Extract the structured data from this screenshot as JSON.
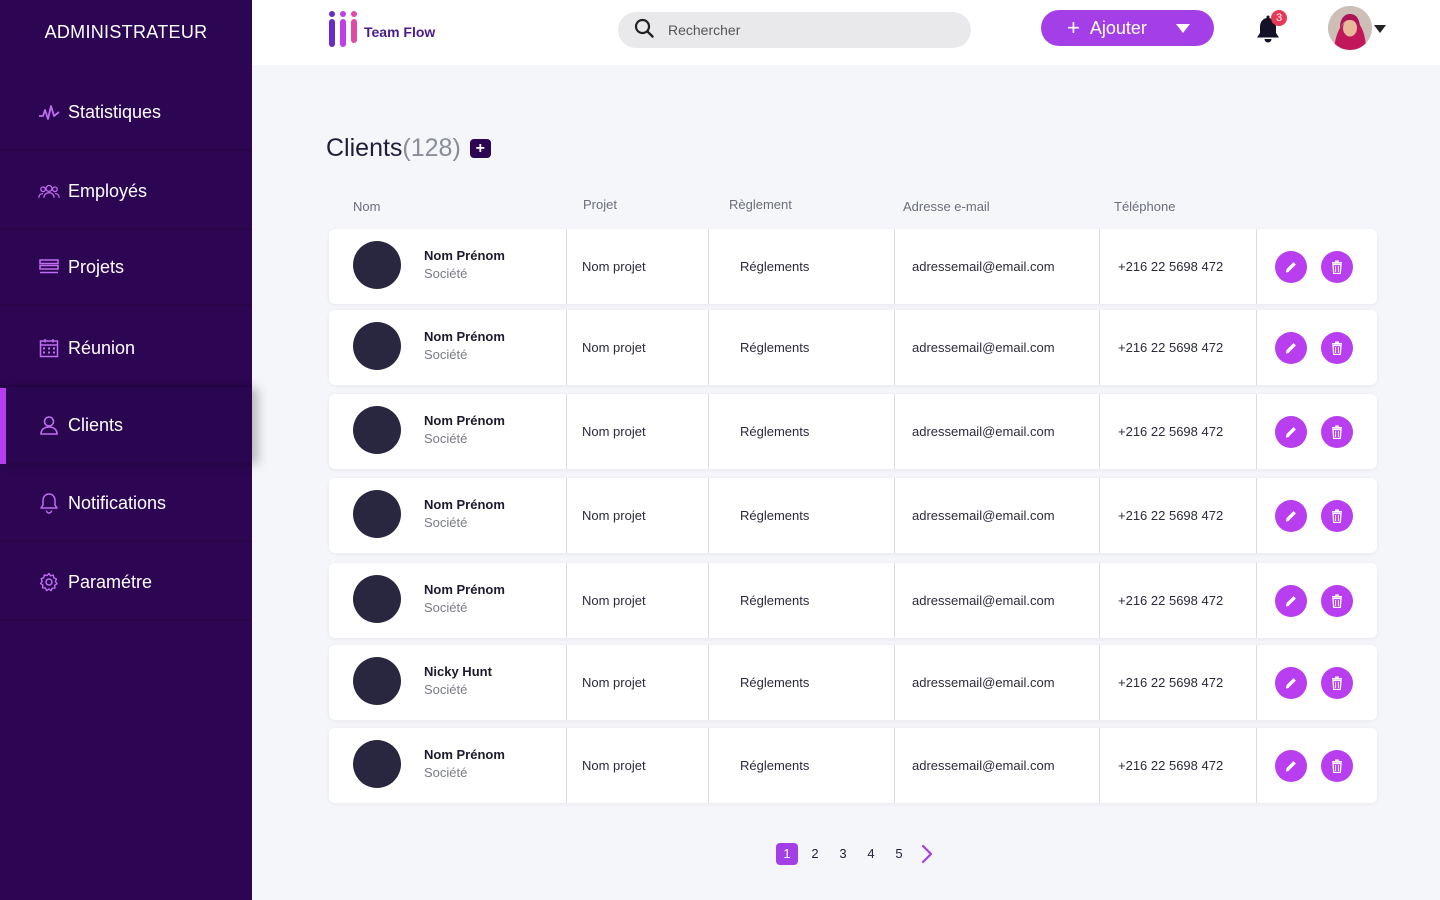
{
  "sidebar": {
    "title": "ADMINISTRATEUR",
    "items": [
      {
        "label": "Statistiques",
        "icon": "pulse-icon"
      },
      {
        "label": "Employés",
        "icon": "group-icon"
      },
      {
        "label": "Projets",
        "icon": "layers-icon"
      },
      {
        "label": "Réunion",
        "icon": "calendar-icon"
      },
      {
        "label": "Clients",
        "icon": "user-icon",
        "active": true
      },
      {
        "label": "Notifications",
        "icon": "bell-icon"
      },
      {
        "label": "Paramétre",
        "icon": "gear-icon"
      }
    ]
  },
  "header": {
    "logo_text": "Team Flow",
    "search_placeholder": "Rechercher",
    "add_label": "Ajouter",
    "notification_count": "3"
  },
  "main": {
    "title": "Clients",
    "count": "(128)",
    "columns": {
      "name": "Nom",
      "project": "Projet",
      "payment": "Règlement",
      "email": "Adresse e-mail",
      "phone": "Téléphone"
    },
    "rows": [
      {
        "name": "Nom Prénom",
        "company": "Société",
        "project": "Nom projet",
        "payment": "Réglements",
        "email": "adressemail@email.com",
        "phone": "+216 22 5698 472"
      },
      {
        "name": "Nom Prénom",
        "company": "Société",
        "project": "Nom projet",
        "payment": "Réglements",
        "email": "adressemail@email.com",
        "phone": "+216 22 5698 472"
      },
      {
        "name": "Nom Prénom",
        "company": "Société",
        "project": "Nom projet",
        "payment": "Réglements",
        "email": "adressemail@email.com",
        "phone": "+216 22 5698 472"
      },
      {
        "name": "Nom Prénom",
        "company": "Société",
        "project": "Nom projet",
        "payment": "Réglements",
        "email": "adressemail@email.com",
        "phone": "+216 22 5698 472"
      },
      {
        "name": "Nom Prénom",
        "company": "Société",
        "project": "Nom projet",
        "payment": "Réglements",
        "email": "adressemail@email.com",
        "phone": "+216 22 5698 472"
      },
      {
        "name": "Nicky Hunt",
        "company": "Société",
        "project": "Nom projet",
        "payment": "Réglements",
        "email": "adressemail@email.com",
        "phone": "+216 22 5698 472"
      },
      {
        "name": "Nom Prénom",
        "company": "Société",
        "project": "Nom projet",
        "payment": "Réglements",
        "email": "adressemail@email.com",
        "phone": "+216 22 5698 472"
      }
    ]
  },
  "pagination": {
    "pages": [
      "1",
      "2",
      "3",
      "4",
      "5"
    ],
    "active": "1"
  },
  "colors": {
    "sidebar": "#2c0653",
    "accent": "#a43fe8",
    "action_button": "#b83ef0",
    "badge": "#e83a57"
  }
}
